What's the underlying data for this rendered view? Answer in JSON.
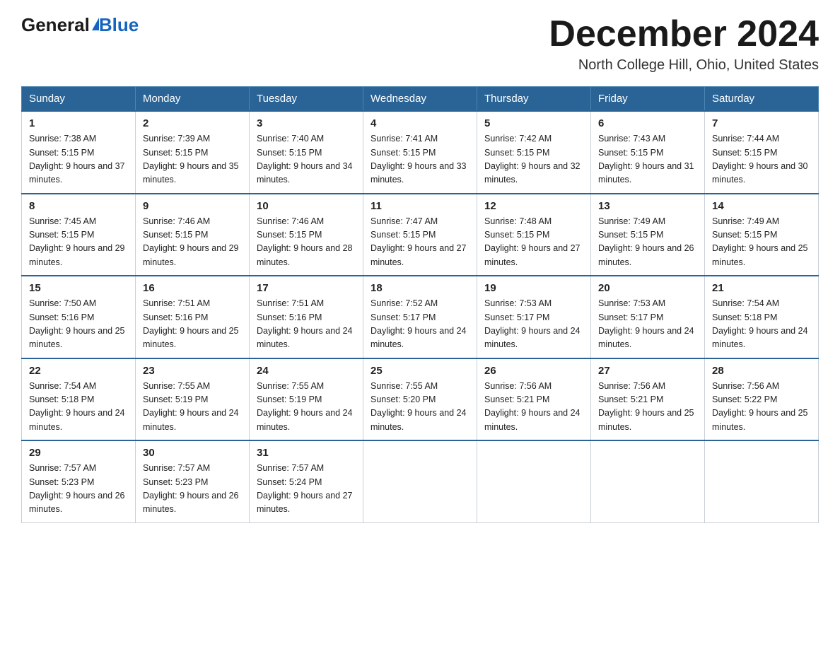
{
  "header": {
    "logo_general": "General",
    "logo_blue": "Blue",
    "month_title": "December 2024",
    "location": "North College Hill, Ohio, United States"
  },
  "days_of_week": [
    "Sunday",
    "Monday",
    "Tuesday",
    "Wednesday",
    "Thursday",
    "Friday",
    "Saturday"
  ],
  "weeks": [
    [
      {
        "day": "1",
        "sunrise": "7:38 AM",
        "sunset": "5:15 PM",
        "daylight": "9 hours and 37 minutes."
      },
      {
        "day": "2",
        "sunrise": "7:39 AM",
        "sunset": "5:15 PM",
        "daylight": "9 hours and 35 minutes."
      },
      {
        "day": "3",
        "sunrise": "7:40 AM",
        "sunset": "5:15 PM",
        "daylight": "9 hours and 34 minutes."
      },
      {
        "day": "4",
        "sunrise": "7:41 AM",
        "sunset": "5:15 PM",
        "daylight": "9 hours and 33 minutes."
      },
      {
        "day": "5",
        "sunrise": "7:42 AM",
        "sunset": "5:15 PM",
        "daylight": "9 hours and 32 minutes."
      },
      {
        "day": "6",
        "sunrise": "7:43 AM",
        "sunset": "5:15 PM",
        "daylight": "9 hours and 31 minutes."
      },
      {
        "day": "7",
        "sunrise": "7:44 AM",
        "sunset": "5:15 PM",
        "daylight": "9 hours and 30 minutes."
      }
    ],
    [
      {
        "day": "8",
        "sunrise": "7:45 AM",
        "sunset": "5:15 PM",
        "daylight": "9 hours and 29 minutes."
      },
      {
        "day": "9",
        "sunrise": "7:46 AM",
        "sunset": "5:15 PM",
        "daylight": "9 hours and 29 minutes."
      },
      {
        "day": "10",
        "sunrise": "7:46 AM",
        "sunset": "5:15 PM",
        "daylight": "9 hours and 28 minutes."
      },
      {
        "day": "11",
        "sunrise": "7:47 AM",
        "sunset": "5:15 PM",
        "daylight": "9 hours and 27 minutes."
      },
      {
        "day": "12",
        "sunrise": "7:48 AM",
        "sunset": "5:15 PM",
        "daylight": "9 hours and 27 minutes."
      },
      {
        "day": "13",
        "sunrise": "7:49 AM",
        "sunset": "5:15 PM",
        "daylight": "9 hours and 26 minutes."
      },
      {
        "day": "14",
        "sunrise": "7:49 AM",
        "sunset": "5:15 PM",
        "daylight": "9 hours and 25 minutes."
      }
    ],
    [
      {
        "day": "15",
        "sunrise": "7:50 AM",
        "sunset": "5:16 PM",
        "daylight": "9 hours and 25 minutes."
      },
      {
        "day": "16",
        "sunrise": "7:51 AM",
        "sunset": "5:16 PM",
        "daylight": "9 hours and 25 minutes."
      },
      {
        "day": "17",
        "sunrise": "7:51 AM",
        "sunset": "5:16 PM",
        "daylight": "9 hours and 24 minutes."
      },
      {
        "day": "18",
        "sunrise": "7:52 AM",
        "sunset": "5:17 PM",
        "daylight": "9 hours and 24 minutes."
      },
      {
        "day": "19",
        "sunrise": "7:53 AM",
        "sunset": "5:17 PM",
        "daylight": "9 hours and 24 minutes."
      },
      {
        "day": "20",
        "sunrise": "7:53 AM",
        "sunset": "5:17 PM",
        "daylight": "9 hours and 24 minutes."
      },
      {
        "day": "21",
        "sunrise": "7:54 AM",
        "sunset": "5:18 PM",
        "daylight": "9 hours and 24 minutes."
      }
    ],
    [
      {
        "day": "22",
        "sunrise": "7:54 AM",
        "sunset": "5:18 PM",
        "daylight": "9 hours and 24 minutes."
      },
      {
        "day": "23",
        "sunrise": "7:55 AM",
        "sunset": "5:19 PM",
        "daylight": "9 hours and 24 minutes."
      },
      {
        "day": "24",
        "sunrise": "7:55 AM",
        "sunset": "5:19 PM",
        "daylight": "9 hours and 24 minutes."
      },
      {
        "day": "25",
        "sunrise": "7:55 AM",
        "sunset": "5:20 PM",
        "daylight": "9 hours and 24 minutes."
      },
      {
        "day": "26",
        "sunrise": "7:56 AM",
        "sunset": "5:21 PM",
        "daylight": "9 hours and 24 minutes."
      },
      {
        "day": "27",
        "sunrise": "7:56 AM",
        "sunset": "5:21 PM",
        "daylight": "9 hours and 25 minutes."
      },
      {
        "day": "28",
        "sunrise": "7:56 AM",
        "sunset": "5:22 PM",
        "daylight": "9 hours and 25 minutes."
      }
    ],
    [
      {
        "day": "29",
        "sunrise": "7:57 AM",
        "sunset": "5:23 PM",
        "daylight": "9 hours and 26 minutes."
      },
      {
        "day": "30",
        "sunrise": "7:57 AM",
        "sunset": "5:23 PM",
        "daylight": "9 hours and 26 minutes."
      },
      {
        "day": "31",
        "sunrise": "7:57 AM",
        "sunset": "5:24 PM",
        "daylight": "9 hours and 27 minutes."
      },
      null,
      null,
      null,
      null
    ]
  ]
}
